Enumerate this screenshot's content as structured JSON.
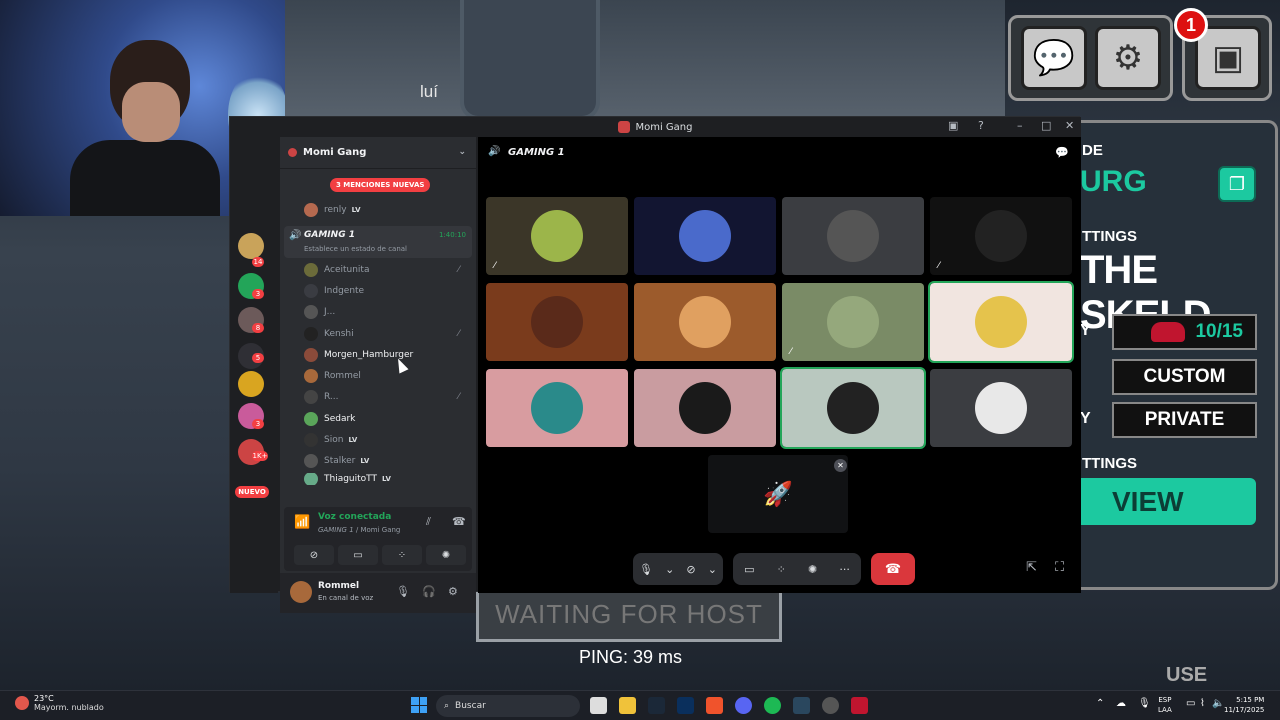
{
  "game": {
    "player_name": "luí",
    "notification_count": "1",
    "panel_heading_fragment": "DE",
    "code_fragment": "URG",
    "settings_label_fragment": "TTINGS",
    "map_name_fragment": "THE SKELD",
    "row_label_fragment_1": "Y",
    "row_label_fragment_2": "Y",
    "player_count": "10/15",
    "game_mode": "CUSTOM",
    "lobby_privacy": "PRIVATE",
    "settings2_label_fragment": "TTINGS",
    "view_button": "VIEW",
    "waiting_text": "WAITING FOR HOST",
    "ping_text": "PING: 39 ms",
    "use_button": "USE",
    "icons": {
      "chat": "chat-bubble-icon",
      "settings": "gear-icon",
      "map": "map-icon",
      "copy": "copy-icon"
    }
  },
  "discord": {
    "window_title": "Momi Gang",
    "server_name": "Momi Gang",
    "mentions_pill": "3 MENCIONES NUEVAS",
    "top_member": {
      "name": "renly",
      "badge": "LV"
    },
    "voice_channel": {
      "name": "GAMING 1",
      "timer": "1:40:10",
      "status_prompt": "Establece un estado de canal"
    },
    "members": [
      {
        "name": "Aceitunita",
        "muted": true,
        "badge": ""
      },
      {
        "name": "Indgente",
        "muted": false,
        "badge": ""
      },
      {
        "name": "J...",
        "muted": false,
        "badge": ""
      },
      {
        "name": "Kenshi",
        "muted": true,
        "badge": ""
      },
      {
        "name": "Morgen_Hamburger",
        "muted": false,
        "badge": ""
      },
      {
        "name": "Rommel",
        "muted": false,
        "badge": ""
      },
      {
        "name": "R...",
        "muted": true,
        "badge": ""
      },
      {
        "name": "Sedark",
        "muted": false,
        "badge": ""
      },
      {
        "name": "Sion",
        "muted": false,
        "badge": "LV"
      },
      {
        "name": "Stalker",
        "muted": false,
        "badge": "LV"
      },
      {
        "name": "ThiaguitoTT",
        "muted": false,
        "badge": "LV"
      }
    ],
    "guild_badges": [
      "14",
      "3",
      "8",
      "5",
      "3",
      "1K+"
    ],
    "new_label": "NUEVO",
    "voice_panel": {
      "status": "Voz conectada",
      "location_channel": "GAMING 1",
      "location_server": "/ Momi Gang"
    },
    "user": {
      "name": "Rommel",
      "status": "En canal de voz"
    },
    "stage_header": "GAMING 1",
    "colors": {
      "accent_green": "#23a559",
      "danger": "#da373c",
      "background": "#1e1f22",
      "sidebar": "#2b2d31"
    }
  },
  "taskbar": {
    "temperature": "23°C",
    "weather": "Mayorm. nublado",
    "search_placeholder": "Buscar",
    "language_line1": "ESP",
    "language_line2": "LAA",
    "time": "5:15 PM",
    "date": "11/17/2025"
  }
}
